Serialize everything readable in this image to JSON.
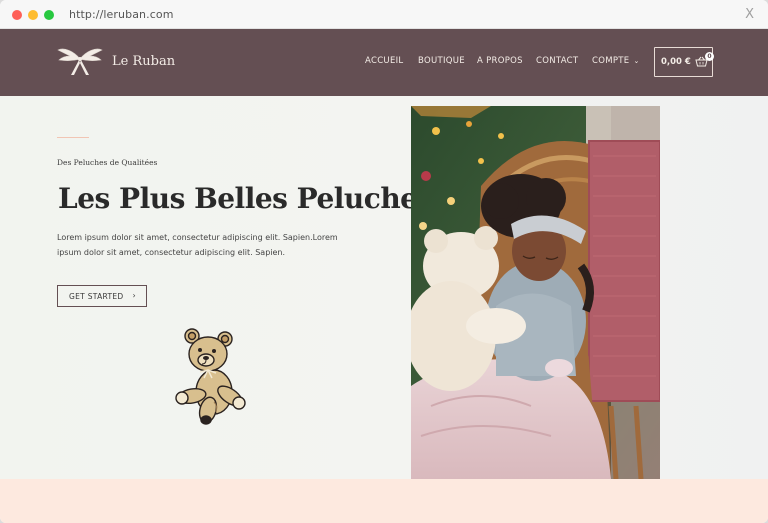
{
  "browser": {
    "url_scheme": "http://",
    "url_host": "leruban.com",
    "close_glyph": "X"
  },
  "header": {
    "brand": "Le Ruban",
    "nav": [
      {
        "label": "ACCUEIL"
      },
      {
        "label": "BOUTIQUE"
      },
      {
        "label": "A PROPOS"
      },
      {
        "label": "CONTACT"
      },
      {
        "label": "COMPTE"
      }
    ],
    "account_chevron": "⌄",
    "cart": {
      "price": "0,00 €",
      "count": "0"
    },
    "colors": {
      "bar": "#644f53",
      "text": "#f3ece6"
    }
  },
  "hero": {
    "subtitle": "Des Peluches de Qualitées",
    "headline": "Les Plus Belles Peluches!",
    "description": "Lorem ipsum dolor sit amet, consectetur adipiscing elit. Sapien.Lorem ipsum dolor sit amet, consectetur adipiscing elit. Sapien.",
    "cta_label": "GET STARTED",
    "cta_chevron": "›",
    "colors": {
      "accent": "#f1c5b4",
      "footer_strip": "#fde9df"
    }
  },
  "icons": {
    "logo": "ribbon-bow-icon",
    "cart": "basket-icon",
    "illustration": "teddy-bear-icon",
    "photo": "child-hugging-teddy-photo"
  }
}
